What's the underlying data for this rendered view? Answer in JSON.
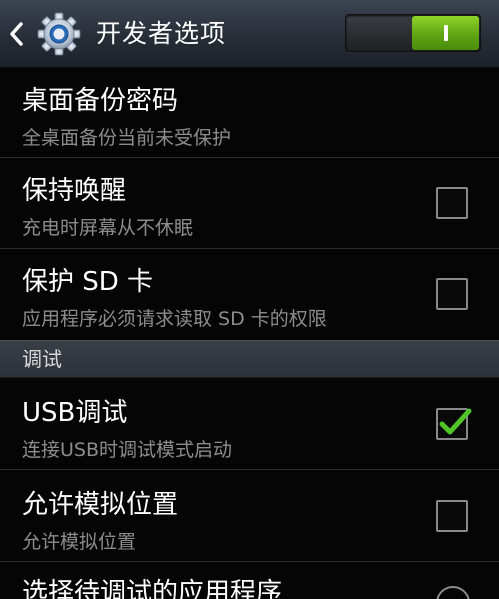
{
  "actionbar": {
    "title": "开发者选项",
    "back_icon": "chevron-left-icon",
    "settings_icon": "gear-icon",
    "switch_state": "on",
    "switch_color": "#6cbb16"
  },
  "rows": [
    {
      "title": "桌面备份密码",
      "subtitle": "全桌面备份当前未受保护"
    },
    {
      "title": "保持唤醒",
      "subtitle": "充电时屏幕从不休眠",
      "checked": false
    },
    {
      "title": "保护 SD 卡",
      "subtitle": "应用程序必须请求读取 SD 卡的权限",
      "checked": false
    }
  ],
  "section": {
    "label": "调试"
  },
  "debug_rows": [
    {
      "title": "USB调试",
      "subtitle": "连接USB时调试模式启动",
      "checked": true
    },
    {
      "title": "允许模拟位置",
      "subtitle": "允许模拟位置",
      "checked": false
    },
    {
      "title": "选择待调试的应用程序"
    }
  ],
  "accent_color": "#4fc52a"
}
